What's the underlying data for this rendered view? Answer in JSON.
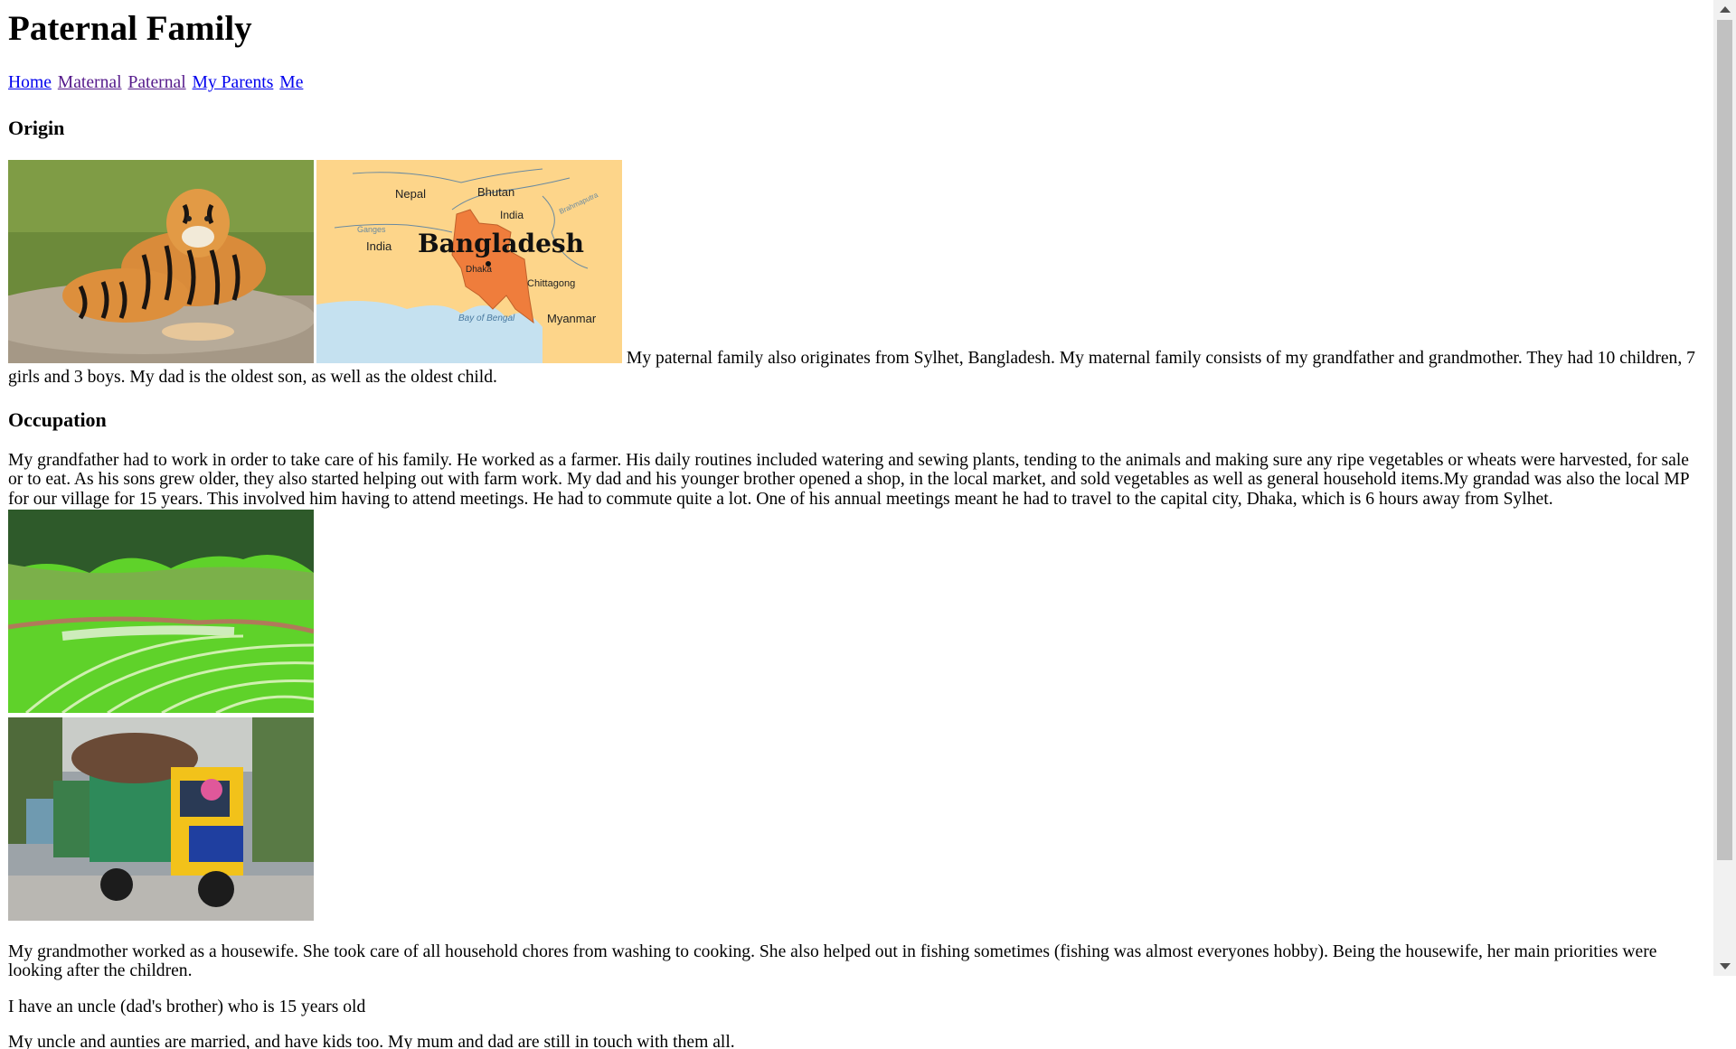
{
  "page": {
    "title": "Paternal Family"
  },
  "nav": {
    "links": [
      {
        "label": "Home",
        "visited": false
      },
      {
        "label": "Maternal",
        "visited": true
      },
      {
        "label": "Paternal",
        "visited": true
      },
      {
        "label": "My Parents",
        "visited": false
      },
      {
        "label": "Me",
        "visited": false
      }
    ]
  },
  "origin": {
    "heading": "Origin",
    "text": "My paternal family also originates from Sylhet, Bangladesh. My maternal family consists of my grandfather and grandmother. They had 10 children, 7 girls and 3 boys. My dad is the oldest son, as well as the oldest child.",
    "map": {
      "title": "Bangladesh",
      "labels": [
        "Nepal",
        "Bhutan",
        "India",
        "India",
        "Brahmaputra",
        "Ganges",
        "Dhaka",
        "Chittagong",
        "Bay of Bengal",
        "Myanmar"
      ]
    }
  },
  "occupation": {
    "heading": "Occupation",
    "text": "My grandfather had to work in order to take care of his family. He worked as a farmer. His daily routines included watering and sewing plants, tending to the animals and making sure any ripe vegetables or wheats were harvested, for sale or to eat. As his sons grew older, they also started helping out with farm work. My dad and his younger brother opened a shop, in the local market, and sold vegetables as well as general household items.My grandad was also the local MP for our village for 15 years. This involved him having to attend meetings. He had to commute quite a lot. One of his annual meetings meant he had to travel to the capital city, Dhaka, which is 6 hours away from Sylhet.",
    "grandmother_text": "My grandmother worked as a housewife. She took care of all household chores from washing to cooking. She also helped out in fishing sometimes (fishing was almost everyones hobby). Being the housewife, her main priorities were looking after the children.",
    "uncle_text": "I have an uncle (dad's brother) who is 15 years old",
    "cut_text": "My uncle and aunties are married, and have kids too. My mum and dad are still in touch with them all."
  },
  "colors": {
    "link": "#0000ee",
    "link_visited": "#551a8b",
    "map_land": "#fdd58a",
    "map_bangladesh": "#ef7d3c",
    "map_water": "#c5e1f0",
    "field_green": "#5fd22a"
  }
}
